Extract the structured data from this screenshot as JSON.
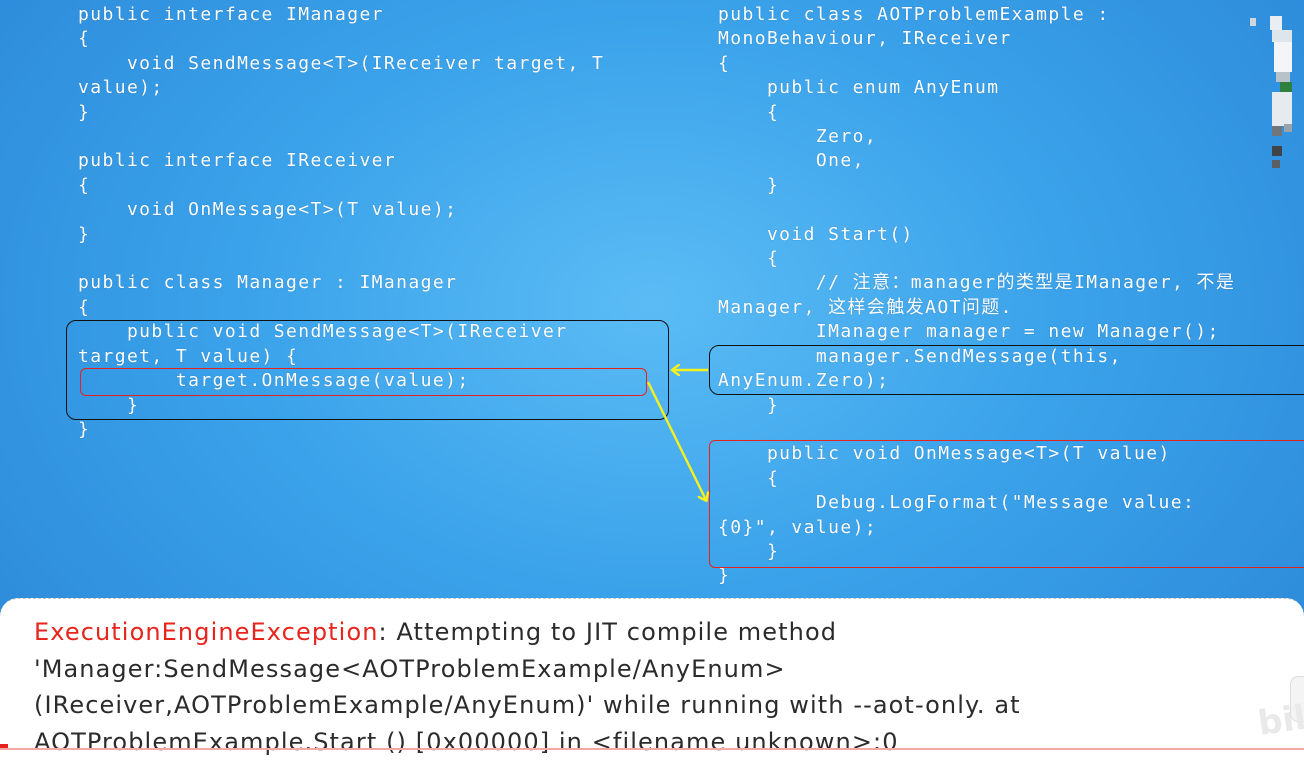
{
  "code_left": {
    "lines": [
      "public interface IManager",
      "{",
      "    void SendMessage<T>(IReceiver target, T",
      "value);",
      "}",
      "",
      "public interface IReceiver",
      "{",
      "    void OnMessage<T>(T value);",
      "}",
      "",
      "public class Manager : IManager",
      "{",
      "    public void SendMessage<T>(IReceiver",
      "target, T value) {",
      "        target.OnMessage(value);",
      "    }",
      "}"
    ]
  },
  "code_right": {
    "lines": [
      "public class AOTProblemExample :",
      "MonoBehaviour, IReceiver",
      "{",
      "    public enum AnyEnum",
      "    {",
      "        Zero,",
      "        One,",
      "    }",
      "",
      "    void Start()",
      "    {",
      "        // 注意：manager的类型是IManager, 不是",
      "Manager, 这样会触发AOT问题.",
      "        IManager manager = new Manager();",
      "        manager.SendMessage(this,",
      "AnyEnum.Zero);",
      "    }",
      "",
      "    public void OnMessage<T>(T value)",
      "    {",
      "        Debug.LogFormat(\"Message value:",
      "{0}\", value);",
      "    }",
      "}"
    ]
  },
  "error": {
    "type": "ExecutionEngineException",
    "message": ": Attempting to JIT compile method 'Manager:SendMessage<AOTProblemExample/AnyEnum> (IReceiver,AOTProblemExample/AnyEnum)' while running with --aot-only. at AOTProblemExample.Start () [0x00000] in <filename unknown>:0"
  },
  "colors": {
    "background": "#3aa2ea",
    "code_text": "#ffffff",
    "box_black": "#111111",
    "box_red": "#e5221d",
    "arrow": "#f5f01e",
    "error_type": "#e8241c",
    "error_text": "#2b2b2b"
  },
  "watermark": "bili"
}
